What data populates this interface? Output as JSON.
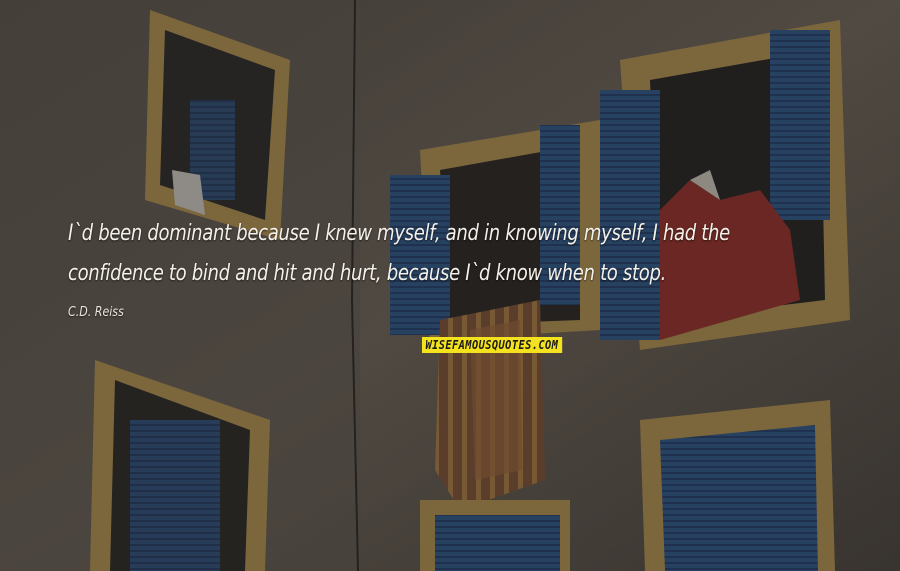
{
  "quote": {
    "line1": "I`d been dominant because I knew myself, and in knowing myself, I had the",
    "line2": "confidence to bind and hit and hurt, because I`d know when to stop."
  },
  "author": "C.D. Reiss",
  "watermark": "WISEFAMOUSQUOTES.COM",
  "colors": {
    "wall": "#6b6258",
    "shutter_blue": "#2f5f9c",
    "window_frame": "#c9a45a",
    "fabric_red": "#a8302a",
    "watermark_bg": "#f5e21e"
  }
}
